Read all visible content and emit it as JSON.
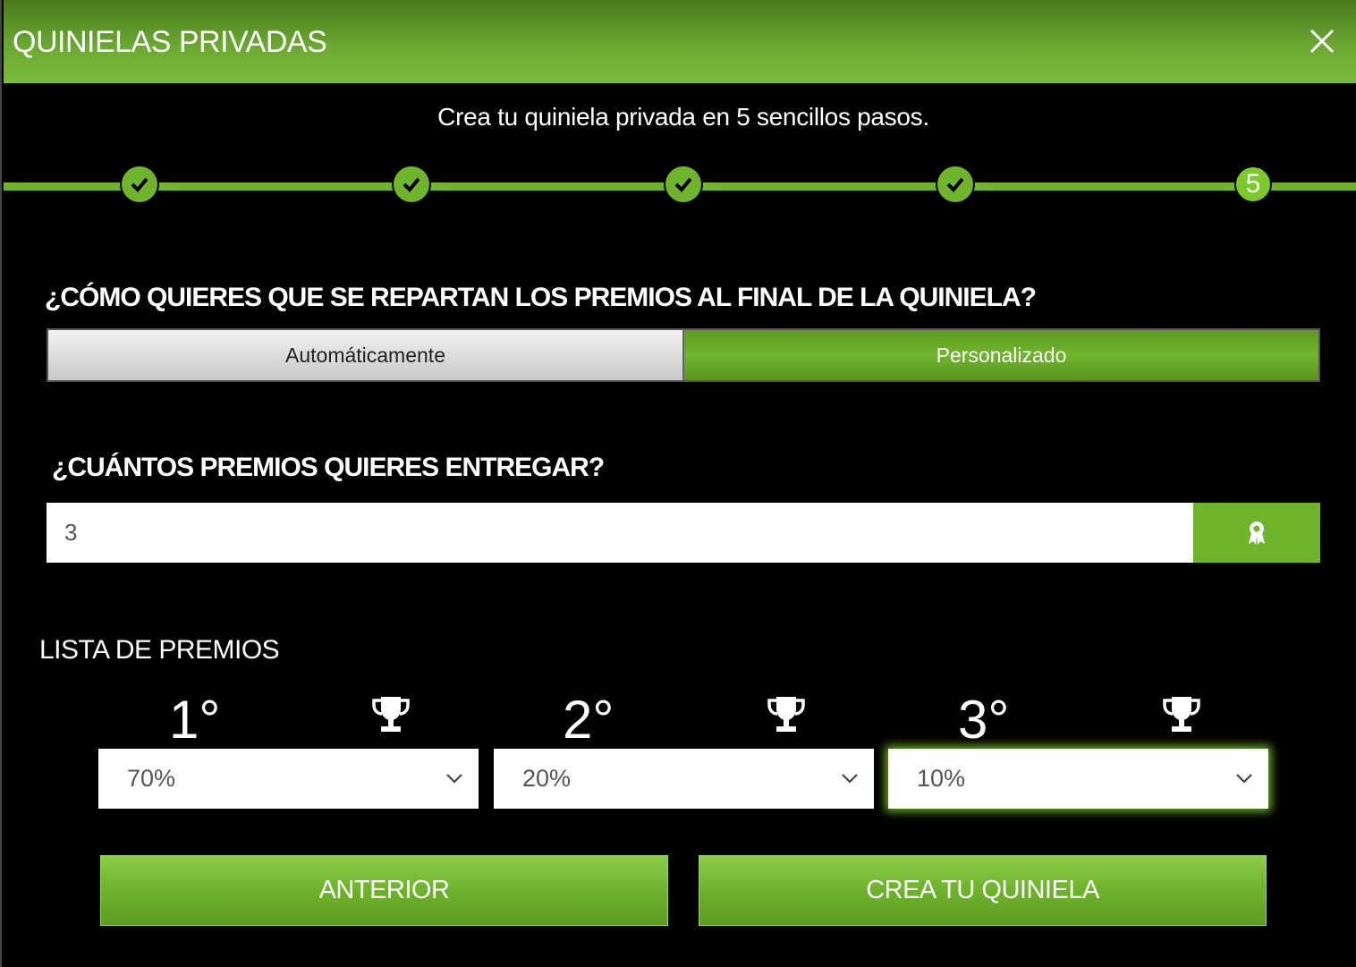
{
  "header": {
    "title": "QUINIELAS PRIVADAS",
    "close_icon": "close-icon"
  },
  "subtitle": "Crea tu quiniela privada en 5 sencillos pasos.",
  "stepper": {
    "steps": [
      {
        "state": "completed",
        "icon": "check-icon"
      },
      {
        "state": "completed",
        "icon": "check-icon"
      },
      {
        "state": "completed",
        "icon": "check-icon"
      },
      {
        "state": "completed",
        "icon": "check-icon"
      },
      {
        "state": "current",
        "label": "5"
      }
    ]
  },
  "distribution": {
    "question": "¿CÓMO QUIERES QUE SE REPARTAN LOS PREMIOS AL FINAL DE LA QUINIELA?",
    "options": [
      "Automáticamente",
      "Personalizado"
    ],
    "selected": "Personalizado"
  },
  "prize_count": {
    "question": "¿CUÁNTOS PREMIOS QUIERES ENTREGAR?",
    "value": "3",
    "button_icon": "award-ribbon-icon"
  },
  "prize_list": {
    "title": "LISTA DE PREMIOS",
    "prizes": [
      {
        "place": "1°",
        "value": "70%",
        "icon": "trophy-icon"
      },
      {
        "place": "2°",
        "value": "20%",
        "icon": "trophy-icon"
      },
      {
        "place": "3°",
        "value": "10%",
        "icon": "trophy-icon"
      }
    ]
  },
  "actions": {
    "back_label": "ANTERIOR",
    "create_label": "CREA TU QUINIELA"
  },
  "colors": {
    "accent": "#6fb52c",
    "background": "#000000",
    "header_dark": "#4a7a1c"
  }
}
